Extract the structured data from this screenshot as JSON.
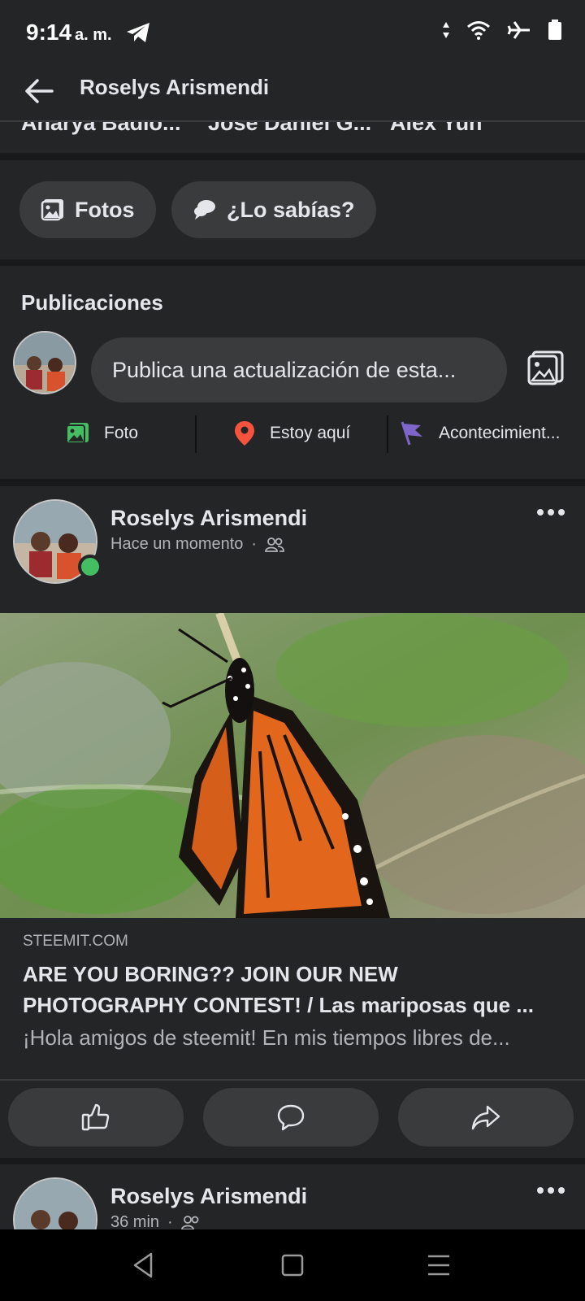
{
  "status_bar": {
    "time": "9:14",
    "ampm": "a. m."
  },
  "header": {
    "title": "Roselys Arismendi"
  },
  "friends_strip": {
    "names": [
      "Anarya Badio...",
      "Jose Daniel G...",
      "Alex Yun"
    ]
  },
  "chips": [
    {
      "label": "Fotos",
      "icon": "photos-icon"
    },
    {
      "label": "¿Lo sabías?",
      "icon": "speech-bubble-icon"
    }
  ],
  "publications": {
    "title": "Publicaciones",
    "composer_placeholder": "Publica una actualización de esta...",
    "actions": [
      {
        "label": "Foto",
        "icon": "photo-icon",
        "color": "#45bd62"
      },
      {
        "label": "Estoy aquí",
        "icon": "location-pin-icon",
        "color": "#f5533d"
      },
      {
        "label": "Acontecimient...",
        "icon": "flag-icon",
        "color": "#7e65c9"
      }
    ]
  },
  "post": {
    "author": "Roselys Arismendi",
    "time": "Hace un momento",
    "audience_icon": "friends-icon",
    "link": {
      "domain": "STEEMIT.COM",
      "title_line1": "ARE YOU BORING?? JOIN OUR NEW",
      "title_line2": "PHOTOGRAPHY CONTEST! / Las mariposas que ...",
      "description": "¡Hola amigos de steemit! En mis tiempos libres de..."
    },
    "buttons": [
      {
        "icon": "like-icon"
      },
      {
        "icon": "comment-icon"
      },
      {
        "icon": "share-icon"
      }
    ]
  },
  "post2": {
    "author": "Roselys Arismendi",
    "time": "36 min"
  },
  "colors": {
    "background": "#18191a",
    "surface": "#242526",
    "chip": "#3a3b3c",
    "online": "#45bd62"
  }
}
